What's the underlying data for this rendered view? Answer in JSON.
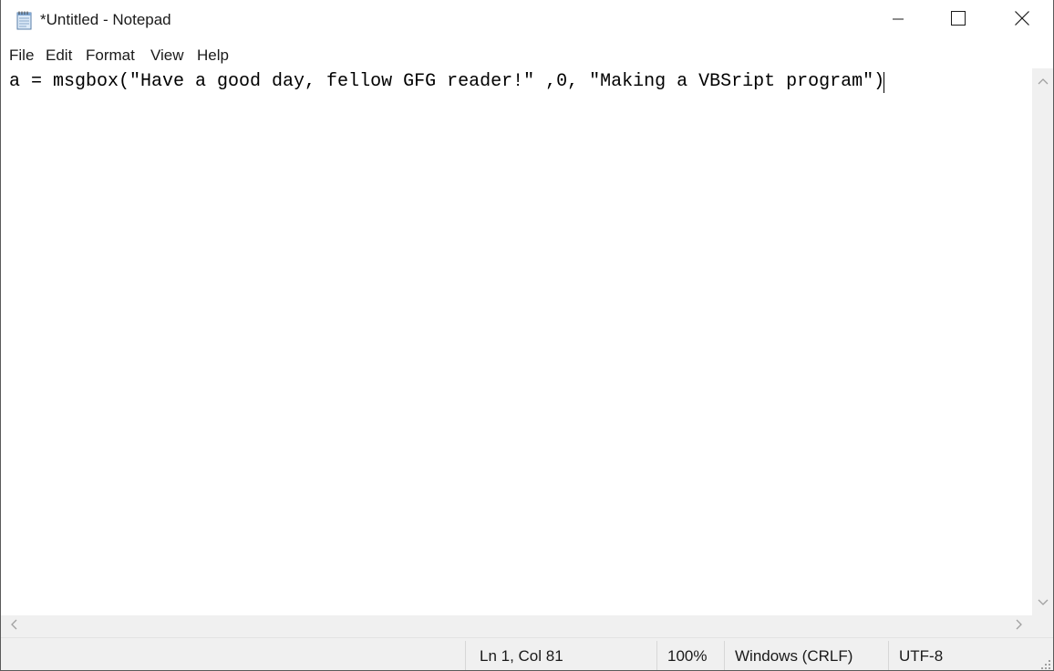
{
  "window": {
    "title": "*Untitled - Notepad",
    "app_icon": "notepad-icon"
  },
  "caption_buttons": {
    "minimize_icon": "minimize-icon",
    "maximize_icon": "maximize-icon",
    "close_icon": "close-icon"
  },
  "menu": {
    "items": [
      {
        "label": "File"
      },
      {
        "label": "Edit"
      },
      {
        "label": "Format"
      },
      {
        "label": "View"
      },
      {
        "label": "Help"
      }
    ]
  },
  "editor": {
    "content": "a = msgbox(\"Have a good day, fellow GFG reader!\" ,0, \"Making a VBSript program\")"
  },
  "statusbar": {
    "position": "Ln 1, Col 81",
    "zoom": "100%",
    "line_ending": "Windows (CRLF)",
    "encoding": "UTF-8"
  },
  "colors": {
    "text": "#1a1a1a",
    "scrollbar": "#f0f0f0",
    "arrow": "#a0a0a0",
    "window_border": "#5a5a5a"
  }
}
